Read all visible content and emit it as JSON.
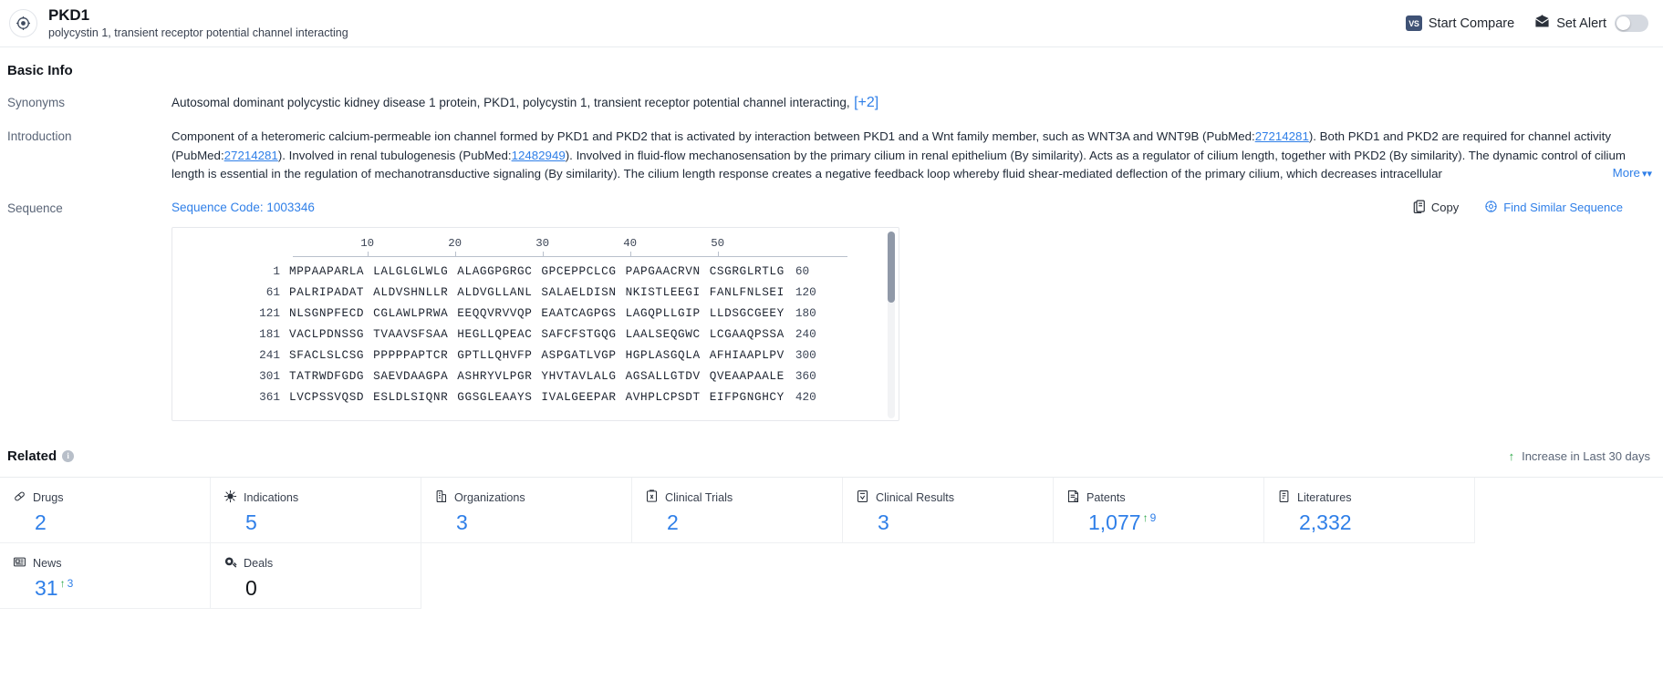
{
  "header": {
    "title": "PKD1",
    "subtitle": "polycystin 1, transient receptor potential channel interacting",
    "start_compare_label": "Start Compare",
    "vs_badge": "VS",
    "set_alert_label": "Set Alert",
    "brand_icon": "target-gene-icon"
  },
  "basic_info": {
    "section_title": "Basic Info",
    "synonyms_label": "Synonyms",
    "synonyms_text": "Autosomal dominant polycystic kidney disease 1 protein,  PKD1,  polycystin 1, transient receptor potential channel interacting,",
    "synonyms_more": "[+2]",
    "introduction_label": "Introduction",
    "introduction_segments": [
      {
        "type": "text",
        "value": "Component of a heteromeric calcium-permeable ion channel formed by PKD1 and PKD2 that is activated by interaction between PKD1 and a Wnt family member, such as WNT3A and WNT9B (PubMed:"
      },
      {
        "type": "link",
        "value": "27214281"
      },
      {
        "type": "text",
        "value": "). Both PKD1 and PKD2 are required for channel activity (PubMed:"
      },
      {
        "type": "link",
        "value": "27214281"
      },
      {
        "type": "text",
        "value": "). Involved in renal tubulogenesis (PubMed:"
      },
      {
        "type": "link",
        "value": "12482949"
      },
      {
        "type": "text",
        "value": "). Involved in fluid-flow mechanosensation by the primary cilium in renal epithelium (By similarity). Acts as a regulator of cilium length, together with PKD2 (By similarity). The dynamic control of cilium length is essential in the regulation of mechanotransductive signaling (By similarity). The cilium length response creates a negative feedback loop whereby fluid shear-mediated deflection of the primary cilium, which decreases intracellular"
      }
    ],
    "more_label": "More"
  },
  "sequence": {
    "label": "Sequence",
    "code_label": "Sequence Code: 1003346",
    "copy_label": "Copy",
    "find_similar_label": "Find Similar Sequence",
    "ruler_ticks": [
      10,
      20,
      30,
      40,
      50
    ],
    "rows": [
      {
        "start": "1",
        "chunks": [
          "MPPAAPARLA",
          "LALGLGLWLG",
          "ALAGGPGRGC",
          "GPCEPPCLCG",
          "PAPGAACRVN",
          "CSGRGLRTLG"
        ],
        "end": "60"
      },
      {
        "start": "61",
        "chunks": [
          "PALRIPADAT",
          "ALDVSHNLLR",
          "ALDVGLLANL",
          "SALAELDISN",
          "NKISTLEEGI",
          "FANLFNLSEI"
        ],
        "end": "120"
      },
      {
        "start": "121",
        "chunks": [
          "NLSGNPFECD",
          "CGLAWLPRWA",
          "EEQQVRVVQP",
          "EAATCAGPGS",
          "LAGQPLLGIP",
          "LLDSGCGEEY"
        ],
        "end": "180"
      },
      {
        "start": "181",
        "chunks": [
          "VACLPDNSSG",
          "TVAAVSFSAA",
          "HEGLLQPEAC",
          "SAFCFSTGQG",
          "LAALSEQGWC",
          "LCGAAQPSSA"
        ],
        "end": "240"
      },
      {
        "start": "241",
        "chunks": [
          "SFACLSLCSG",
          "PPPPPAPTCR",
          "GPTLLQHVFP",
          "ASPGATLVGP",
          "HGPLASGQLA",
          "AFHIAAPLPV"
        ],
        "end": "300"
      },
      {
        "start": "301",
        "chunks": [
          "TATRWDFGDG",
          "SAEVDAAGPA",
          "ASHRYVLPGR",
          "YHVTAVLALG",
          "AGSALLGTDV",
          "QVEAAPAALE"
        ],
        "end": "360"
      },
      {
        "start": "361",
        "chunks": [
          "LVCPSSVQSD",
          "ESLDLSIQNR",
          "GGSGLEAAYS",
          "IVALGEEPAR",
          "AVHPLCPSDT",
          "EIFPGNGHCY"
        ],
        "end": "420"
      }
    ]
  },
  "related": {
    "title": "Related",
    "info_glyph": "i",
    "increase_note": "Increase in Last 30 days",
    "stats": [
      {
        "label": "Drugs",
        "icon": "capsule-icon",
        "value": "2",
        "delta": null,
        "dark": false
      },
      {
        "label": "Indications",
        "icon": "virus-icon",
        "value": "5",
        "delta": null,
        "dark": false
      },
      {
        "label": "Organizations",
        "icon": "building-icon",
        "value": "3",
        "delta": null,
        "dark": false
      },
      {
        "label": "Clinical Trials",
        "icon": "clipboard-trial-icon",
        "value": "2",
        "delta": null,
        "dark": false
      },
      {
        "label": "Clinical Results",
        "icon": "results-icon",
        "value": "3",
        "delta": null,
        "dark": false
      },
      {
        "label": "Patents",
        "icon": "patent-icon",
        "value": "1,077",
        "delta": "9",
        "dark": false
      },
      {
        "label": "Literatures",
        "icon": "book-icon",
        "value": "2,332",
        "delta": null,
        "dark": false
      },
      {
        "label": "News",
        "icon": "news-icon",
        "value": "31",
        "delta": "3",
        "dark": false
      },
      {
        "label": "Deals",
        "icon": "deals-icon",
        "value": "0",
        "delta": null,
        "dark": true
      }
    ]
  },
  "colors": {
    "accent": "#2f7fe8",
    "increase_green": "#2aa745",
    "text_dark": "#11151c",
    "label_gray": "#5a6577"
  }
}
